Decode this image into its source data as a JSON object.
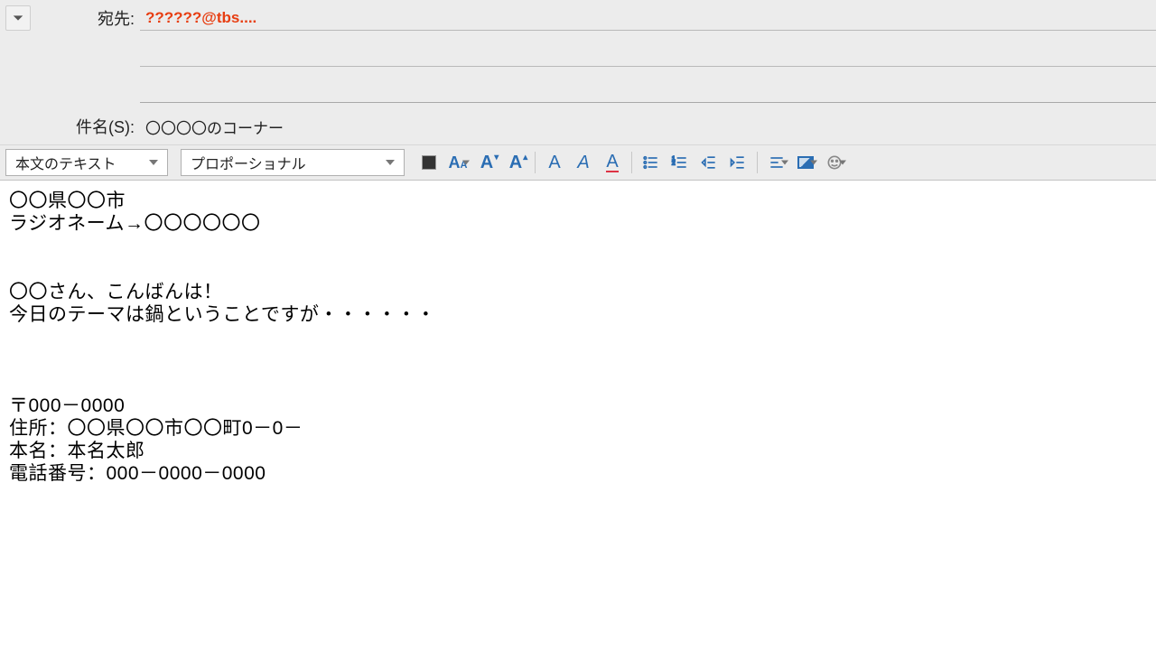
{
  "labels": {
    "to": "宛先:",
    "subject": "件名(S):"
  },
  "fields": {
    "to": "??????@tbs....",
    "cc": "",
    "bcc": "",
    "subject": "〇〇〇〇のコーナー"
  },
  "toolbar": {
    "style_dropdown": "本文のテキスト",
    "font_dropdown": "プロポーショナル"
  },
  "body": {
    "l1": "〇〇県〇〇市",
    "l2": "ラジオネーム→〇〇〇〇〇〇",
    "l3": "",
    "l4": "",
    "l5": "〇〇さん、こんばんは！",
    "l6": "今日のテーマは鍋ということですが・・・・・・",
    "l7": "",
    "l8": "",
    "l9": "",
    "l10": "〒000－0000",
    "l11": "住所：〇〇県〇〇市〇〇町0－0－",
    "l12": "本名：本名太郎",
    "l13": "電話番号：000－0000－0000"
  }
}
